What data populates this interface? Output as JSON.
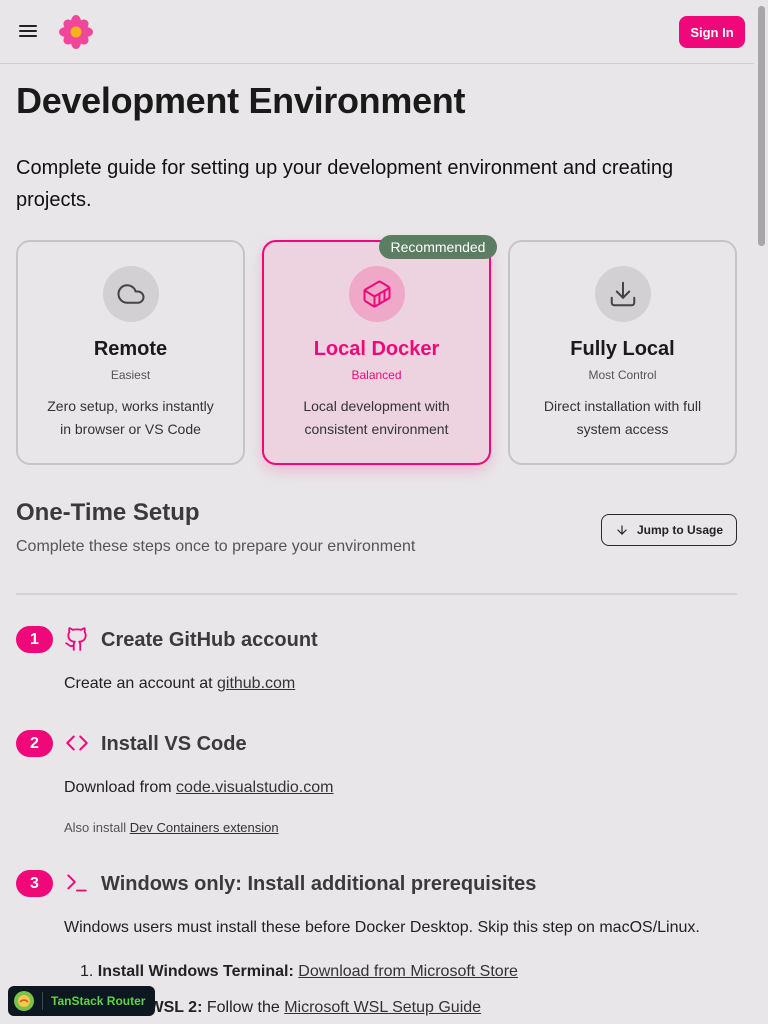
{
  "header": {
    "signin_label": "Sign In",
    "menu_icon": "hamburger-menu-icon",
    "logo_icon": "flower-logo-icon",
    "brand_color": "#f0087a"
  },
  "page": {
    "title": "Development Environment",
    "subtitle": "Complete guide for setting up your development environment and creating projects."
  },
  "options": [
    {
      "title": "Remote",
      "tag": "Easiest",
      "description": "Zero setup, works instantly in browser or VS Code",
      "icon": "cloud-icon",
      "selected": false
    },
    {
      "title": "Local Docker",
      "tag": "Balanced",
      "description": "Local development with consistent environment",
      "icon": "container-icon",
      "selected": true,
      "badge": "Recommended"
    },
    {
      "title": "Fully Local",
      "tag": "Most Control",
      "description": "Direct installation with full system access",
      "icon": "download-icon",
      "selected": false
    }
  ],
  "setup": {
    "title": "One-Time Setup",
    "subtitle": "Complete these steps once to prepare your environment",
    "jump_label": "Jump to Usage"
  },
  "steps": [
    {
      "number": "1",
      "title": "Create GitHub account",
      "icon": "github-icon",
      "text_prefix": "Create an account at ",
      "link": "github.com"
    },
    {
      "number": "2",
      "title": "Install VS Code",
      "icon": "code-icon",
      "text_prefix": "Download from ",
      "link": "code.visualstudio.com",
      "small_prefix": "Also install ",
      "small_link": "Dev Containers extension"
    },
    {
      "number": "3",
      "title": "Windows only: Install additional prerequisites",
      "icon": "terminal-icon",
      "text": "Windows users must install these before Docker Desktop. Skip this step on macOS/Linux.",
      "items": [
        {
          "marker": "1.",
          "label": "Install Windows Terminal:",
          "link": "Download from Microsoft Store"
        },
        {
          "marker": "2.",
          "label": "Install WSL 2:",
          "text": " Follow the ",
          "link": "Microsoft WSL Setup Guide"
        }
      ]
    }
  ],
  "devtools": {
    "label": "TanStack Router"
  }
}
